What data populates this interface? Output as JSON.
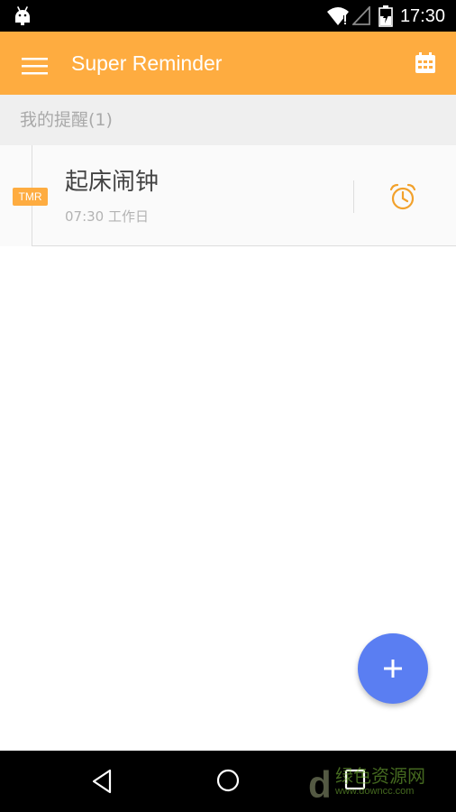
{
  "status_bar": {
    "time": "17:30",
    "icons": [
      "android-icon",
      "wifi-icon",
      "signal-icon",
      "battery-icon"
    ]
  },
  "toolbar": {
    "title": "Super Reminder",
    "menu_icon": "menu-icon",
    "calendar_icon": "calendar-icon",
    "background": "#FEAC40"
  },
  "section": {
    "title": "我的提醒(1)"
  },
  "reminders": [
    {
      "badge": "TMR",
      "title": "起床闹钟",
      "time": "07:30 工作日",
      "icon": "alarm-clock-icon"
    }
  ],
  "fab": {
    "icon": "plus-icon",
    "color": "#5A7EF2"
  },
  "nav_bar": {
    "icons": [
      "back-icon",
      "home-icon",
      "recents-icon"
    ]
  },
  "watermark": {
    "text": "绿色资源网",
    "sub": "www.downcc.com"
  },
  "colors": {
    "accent": "#FEAC40",
    "fab": "#5A7EF2",
    "section_bg": "#EFEFEF"
  }
}
